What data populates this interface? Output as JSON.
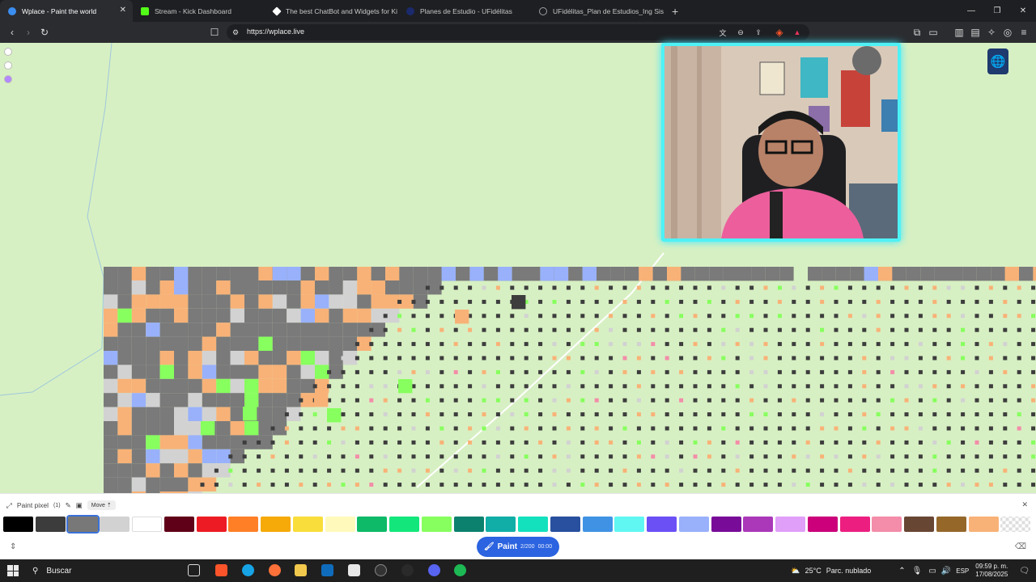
{
  "browser": {
    "tabs": [
      {
        "title": "Wplace - Paint the world",
        "active": true,
        "favicon_color": "#3b8ef0"
      },
      {
        "title": "Stream - Kick Dashboard",
        "active": false,
        "favicon_color": "#53fc18"
      },
      {
        "title": "The best ChatBot and Widgets for Ki",
        "active": false,
        "favicon_color": "#ffffff"
      },
      {
        "title": "Planes de Estudio - UFidélitas",
        "active": false,
        "favicon_color": "#1a2a6c"
      },
      {
        "title": "UFidélitas_Plan de Estudios_Ing Siste",
        "active": false,
        "favicon_color": "#9aa0a6"
      }
    ],
    "new_tab_icon": "+",
    "url": "https://wplace.live",
    "window_controls": [
      "minimize",
      "maximize",
      "close"
    ]
  },
  "paint_panel": {
    "title": "Paint pixel",
    "count": "(1)",
    "move_label": "Move",
    "paint_label": "Paint",
    "charges": "2/200",
    "timer": "00:00",
    "selected_color_index": 2,
    "palette": [
      "#000000",
      "#3c3c3c",
      "#787878",
      "#d2d2d2",
      "#ffffff",
      "#600018",
      "#ed1c24",
      "#ff7f27",
      "#f6aa09",
      "#f9dd3b",
      "#fffabc",
      "#0eb968",
      "#13e67b",
      "#87ff5e",
      "#0c816e",
      "#10aea6",
      "#13e1be",
      "#28509e",
      "#4093e4",
      "#60f7f2",
      "#6b50f6",
      "#99b1fb",
      "#780c99",
      "#aa38b9",
      "#e09ff9",
      "#cb007a",
      "#ec1f80",
      "#f38da9",
      "#684634",
      "#95682a",
      "#f8b277",
      "transparent"
    ]
  },
  "taskbar": {
    "search_placeholder": "Buscar",
    "weather_temp": "25°C",
    "weather_desc": "Parc. nublado",
    "language": "ESP",
    "time": "09:59 p. m.",
    "date": "17/08/2025"
  },
  "colors": {
    "map_background": "#d7f0c3",
    "painted_gray": "#7a7a7a",
    "webcam_border": "#4ff1f5",
    "paint_button": "#2b63e0"
  }
}
